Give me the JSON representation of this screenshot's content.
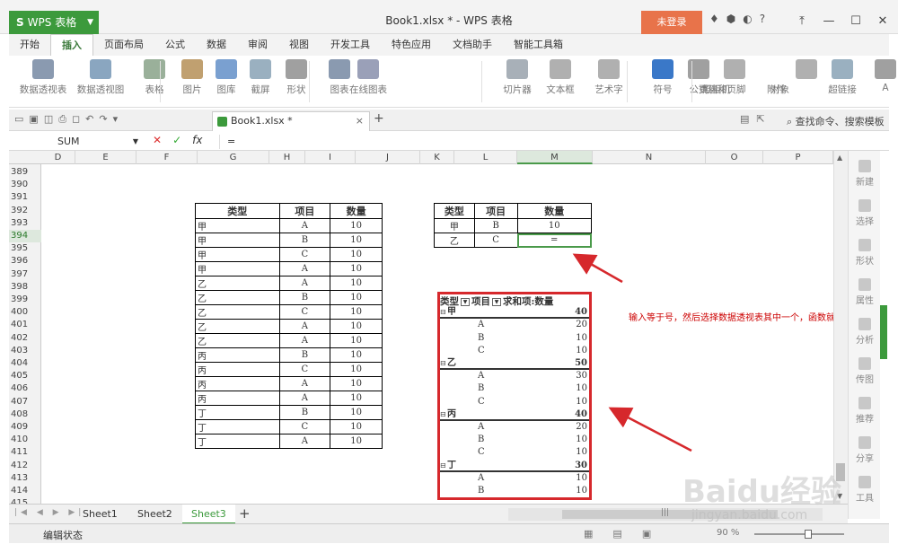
{
  "window": {
    "app_name": "WPS 表格",
    "doc_title": "Book1.xlsx * - WPS 表格",
    "login_label": "未登录",
    "help_label": "?"
  },
  "menu": {
    "tabs": [
      "开始",
      "插入",
      "页面布局",
      "公式",
      "数据",
      "审阅",
      "视图",
      "开发工具",
      "特色应用",
      "文档助手",
      "智能工具箱"
    ],
    "active": "插入"
  },
  "ribbon": {
    "items": [
      "数据透视表",
      "数据透视图",
      "表格",
      "图片",
      "图库",
      "截屏",
      "形状",
      "图表",
      "在线图表",
      "切片器",
      "文本框",
      "艺术字",
      "符号",
      "公式",
      "页眉和页脚",
      "对象",
      "照相机",
      "附件",
      "超链接",
      "A"
    ]
  },
  "doctab": {
    "label": "Book1.xlsx *",
    "close": "×",
    "add": "+",
    "search": "查找命令、搜索模板"
  },
  "formula_bar": {
    "name_box": "SUM",
    "cancel": "✕",
    "ok": "✓",
    "fx": "fx",
    "content": "="
  },
  "columns": [
    "D",
    "E",
    "F",
    "G",
    "H",
    "I",
    "J",
    "K",
    "L",
    "M",
    "N",
    "O",
    "P"
  ],
  "selected_column": "M",
  "rows": [
    "389",
    "390",
    "391",
    "392",
    "393",
    "394",
    "395",
    "396",
    "397",
    "398",
    "399",
    "400",
    "401",
    "402",
    "403",
    "404",
    "405",
    "406",
    "407",
    "408",
    "409",
    "410",
    "411",
    "412",
    "413",
    "414",
    "415"
  ],
  "selected_row": "394",
  "source_table": {
    "headers": [
      "类型",
      "项目",
      "数量"
    ],
    "rows": [
      [
        "甲",
        "A",
        "10"
      ],
      [
        "甲",
        "B",
        "10"
      ],
      [
        "甲",
        "C",
        "10"
      ],
      [
        "甲",
        "A",
        "10"
      ],
      [
        "乙",
        "A",
        "10"
      ],
      [
        "乙",
        "B",
        "10"
      ],
      [
        "乙",
        "C",
        "10"
      ],
      [
        "乙",
        "A",
        "10"
      ],
      [
        "乙",
        "A",
        "10"
      ],
      [
        "丙",
        "B",
        "10"
      ],
      [
        "丙",
        "C",
        "10"
      ],
      [
        "丙",
        "A",
        "10"
      ],
      [
        "丙",
        "A",
        "10"
      ],
      [
        "丁",
        "B",
        "10"
      ],
      [
        "丁",
        "C",
        "10"
      ],
      [
        "丁",
        "A",
        "10"
      ]
    ]
  },
  "lookup_table": {
    "headers": [
      "类型",
      "项目",
      "数量"
    ],
    "rows": [
      [
        "甲",
        "B",
        "10"
      ],
      [
        "乙",
        "C",
        "="
      ]
    ]
  },
  "pivot": {
    "headers": [
      "类型",
      "项目",
      "求和项:数量"
    ],
    "groups": [
      {
        "name": "甲",
        "total": "40",
        "items": [
          [
            "A",
            "20"
          ],
          [
            "B",
            "10"
          ],
          [
            "C",
            "10"
          ]
        ]
      },
      {
        "name": "乙",
        "total": "50",
        "items": [
          [
            "A",
            "30"
          ],
          [
            "B",
            "10"
          ],
          [
            "C",
            "10"
          ]
        ]
      },
      {
        "name": "丙",
        "total": "40",
        "items": [
          [
            "A",
            "20"
          ],
          [
            "B",
            "10"
          ],
          [
            "C",
            "10"
          ]
        ]
      },
      {
        "name": "丁",
        "total": "30",
        "items": [
          [
            "A",
            "10"
          ],
          [
            "B",
            "10"
          ],
          [
            "C",
            ""
          ]
        ]
      }
    ]
  },
  "annotation": "输入等于号，然后选择数据透视表其中一个，函数就有了",
  "task_panel": [
    "新建",
    "选择",
    "形状",
    "属性",
    "分析",
    "传图",
    "推荐",
    "分享",
    "工具"
  ],
  "sheets": [
    "Sheet1",
    "Sheet2",
    "Sheet3"
  ],
  "active_sheet": "Sheet3",
  "status": {
    "mode": "编辑状态",
    "zoom": "90 %"
  },
  "watermark": {
    "main": "Baidu经验",
    "sub": "jingyan.baidu.com"
  },
  "colors": {
    "accent": "#3c9a3c",
    "login": "#e8734a",
    "highlight_box": "#d6282c",
    "annotation": "#cc0000"
  }
}
